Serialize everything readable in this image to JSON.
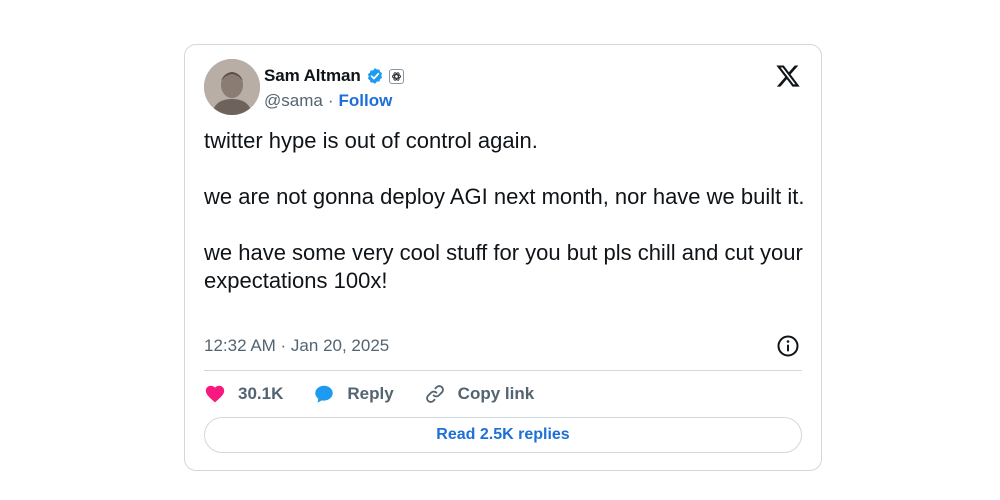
{
  "author": {
    "name": "Sam Altman",
    "handle": "@sama",
    "separator": "·",
    "follow_label": "Follow",
    "verified_icon": "verified-badge-icon",
    "org_icon": "openai-org-icon"
  },
  "platform_icon": "x-logo-icon",
  "tweet": {
    "paragraphs": [
      "twitter hype is out of control again.",
      "we are not gonna deploy AGI next month, nor have we built it.",
      "we have some very cool stuff for you but pls chill and cut your expectations 100x!"
    ],
    "timestamp": "12:32 AM · Jan 20, 2025"
  },
  "actions": {
    "likes": "30.1K",
    "reply_label": "Reply",
    "copy_link_label": "Copy link"
  },
  "read_replies_label": "Read 2.5K replies",
  "colors": {
    "accent": "#1d6fd9",
    "heart": "#f91880",
    "verified": "#1d9bf0",
    "reply_bubble": "#1d9bf0"
  }
}
